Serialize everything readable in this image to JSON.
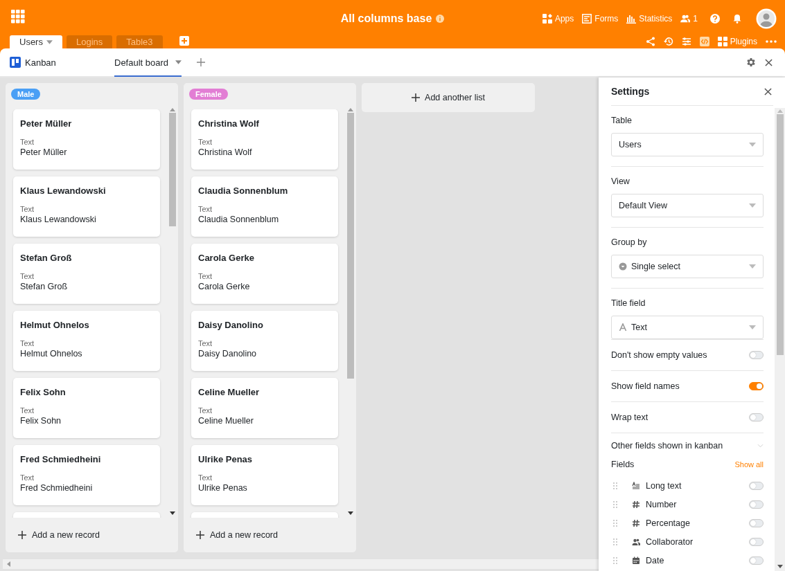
{
  "header": {
    "title": "All columns base",
    "nav": [
      {
        "kind": "apps",
        "label": "Apps"
      },
      {
        "kind": "forms",
        "label": "Forms"
      },
      {
        "kind": "statistics",
        "label": "Statistics"
      },
      {
        "kind": "collaborators",
        "label": "1"
      }
    ],
    "tables": [
      {
        "label": "Users",
        "selected": true
      },
      {
        "label": "Logins",
        "selected": false
      },
      {
        "label": "Table3",
        "selected": false
      }
    ],
    "toolbar": {
      "plugins_label": "Plugins"
    }
  },
  "plugin": {
    "name": "Kanban",
    "boards": [
      {
        "label": "Default board",
        "selected": true
      }
    ]
  },
  "lists": [
    {
      "name": "Male",
      "color": "#4a9ff5",
      "cards": [
        {
          "title": "Peter Müller",
          "field": "Text",
          "value": "Peter Müller"
        },
        {
          "title": "Klaus Lewandowski",
          "field": "Text",
          "value": "Klaus Lewandowski"
        },
        {
          "title": "Stefan Groß",
          "field": "Text",
          "value": "Stefan Groß"
        },
        {
          "title": "Helmut Ohnelos",
          "field": "Text",
          "value": "Helmut Ohnelos"
        },
        {
          "title": "Felix Sohn",
          "field": "Text",
          "value": "Felix Sohn"
        },
        {
          "title": "Fred Schmiedheini",
          "field": "Text",
          "value": "Fred Schmiedheini"
        }
      ],
      "add_label": "Add a new record"
    },
    {
      "name": "Female",
      "color": "#e27ed4",
      "cards": [
        {
          "title": "Christina Wolf",
          "field": "Text",
          "value": "Christina Wolf"
        },
        {
          "title": "Claudia Sonnenblum",
          "field": "Text",
          "value": "Claudia Sonnenblum"
        },
        {
          "title": "Carola Gerke",
          "field": "Text",
          "value": "Carola Gerke"
        },
        {
          "title": "Daisy Danolino",
          "field": "Text",
          "value": "Daisy Danolino"
        },
        {
          "title": "Celine Mueller",
          "field": "Text",
          "value": "Celine Mueller"
        },
        {
          "title": "Ulrike Penas",
          "field": "Text",
          "value": "Ulrike Penas"
        }
      ],
      "add_label": "Add a new record"
    }
  ],
  "add_list_label": "Add another list",
  "settings": {
    "title": "Settings",
    "selects": [
      {
        "kind": "plain",
        "label": "Table",
        "value": "Users",
        "divider": false
      },
      {
        "kind": "plain",
        "label": "View",
        "value": "Default View",
        "divider": true
      },
      {
        "kind": "single_select",
        "label": "Group by",
        "value": "Single select",
        "divider": true
      },
      {
        "kind": "text",
        "label": "Title field",
        "value": "Text",
        "divider": true
      }
    ],
    "toggles": [
      {
        "label": "Don't show empty values",
        "on": false
      },
      {
        "label": "Show field names",
        "on": true
      },
      {
        "label": "Wrap text",
        "on": false
      }
    ],
    "other_fields_label": "Other fields shown in kanban",
    "fields_label": "Fields",
    "show_all_label": "Show all",
    "fields": [
      {
        "kind": "long_text",
        "label": "Long text",
        "on": false
      },
      {
        "kind": "number",
        "label": "Number",
        "on": false
      },
      {
        "kind": "percentage",
        "label": "Percentage",
        "on": false
      },
      {
        "kind": "collaborator",
        "label": "Collaborator",
        "on": false
      },
      {
        "kind": "date",
        "label": "Date",
        "on": false
      }
    ]
  }
}
